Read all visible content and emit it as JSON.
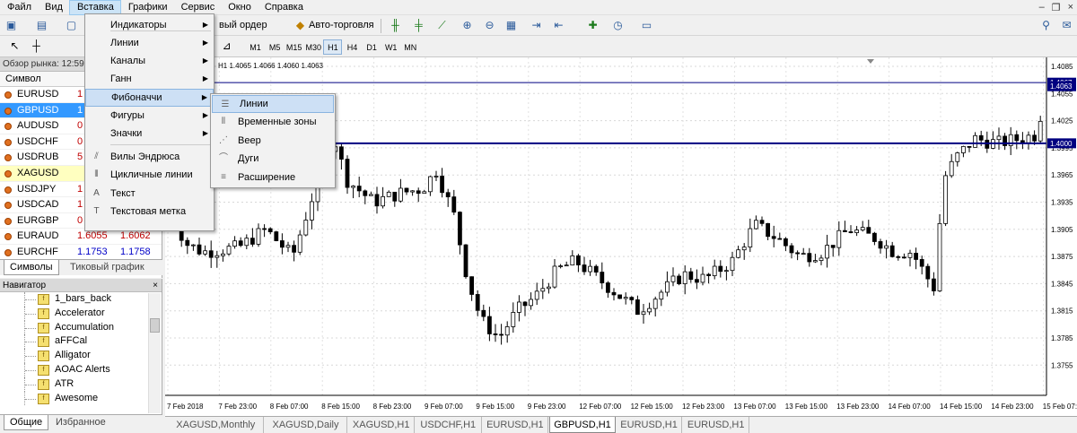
{
  "menubar": {
    "items": [
      "Файл",
      "Вид",
      "Вставка",
      "Графики",
      "Сервис",
      "Окно",
      "Справка"
    ],
    "active": 2
  },
  "toolbar": {
    "new_order": "вый ордер",
    "auto_trading": "Авто-торговля"
  },
  "timeframes": [
    "M1",
    "M5",
    "M15",
    "M30",
    "H1",
    "H4",
    "D1",
    "W1",
    "MN"
  ],
  "timeframe_selected": "H1",
  "market_watch": {
    "title": "Обзор рынка: 12:59",
    "header": "Символ",
    "rows": [
      {
        "symbol": "EURUSD",
        "bid": "1",
        "ask": ""
      },
      {
        "symbol": "GBPUSD",
        "bid": "1",
        "ask": ""
      },
      {
        "symbol": "AUDUSD",
        "bid": "0",
        "ask": ""
      },
      {
        "symbol": "USDCHF",
        "bid": "0",
        "ask": ""
      },
      {
        "symbol": "USDRUB",
        "bid": "5",
        "ask": ""
      },
      {
        "symbol": "XAGUSD",
        "bid": "",
        "ask": ""
      },
      {
        "symbol": "USDJPY",
        "bid": "1",
        "ask": ""
      },
      {
        "symbol": "USDCAD",
        "bid": "1",
        "ask": ""
      },
      {
        "symbol": "EURGBP",
        "bid": "0",
        "ask": ""
      },
      {
        "symbol": "EURAUD",
        "bid": "1.6055",
        "ask": "1.6062"
      },
      {
        "symbol": "EURCHF",
        "bid": "1.1753",
        "ask": "1.1758"
      }
    ],
    "tabs": [
      "Символы",
      "Тиковый график"
    ]
  },
  "navigator": {
    "title": "Навигатор",
    "close": "×",
    "items": [
      "1_bars_back",
      "Accelerator",
      "Accumulation",
      "aFFCal",
      "Alligator",
      "AOAC Alerts",
      "ATR",
      "Awesome"
    ],
    "tabs": [
      "Общие",
      "Избранное"
    ]
  },
  "insert_menu": {
    "items": [
      {
        "label": "Индикаторы",
        "submenu": true
      },
      {
        "label": "Линии",
        "submenu": true
      },
      {
        "label": "Каналы",
        "submenu": true
      },
      {
        "label": "Ганн",
        "submenu": true
      },
      {
        "label": "Фибоначчи",
        "submenu": true,
        "highlight": true
      },
      {
        "label": "Фигуры",
        "submenu": true
      },
      {
        "label": "Значки",
        "submenu": true
      },
      {
        "label": "Вилы Эндрюса",
        "icon": "pitchfork-icon"
      },
      {
        "label": "Цикличные линии",
        "icon": "cycle-lines-icon"
      },
      {
        "label": "Текст",
        "icon": "text-icon"
      },
      {
        "label": "Текстовая метка",
        "icon": "text-label-icon"
      }
    ]
  },
  "fibo_menu": {
    "items": [
      {
        "label": "Линии",
        "icon": "fibo-lines-icon",
        "highlight": true
      },
      {
        "label": "Временные зоны",
        "icon": "fibo-timezones-icon"
      },
      {
        "label": "Веер",
        "icon": "fibo-fan-icon"
      },
      {
        "label": "Дуги",
        "icon": "fibo-arcs-icon"
      },
      {
        "label": "Расширение",
        "icon": "fibo-expansion-icon"
      }
    ]
  },
  "chart": {
    "info": "H1  1.4065 1.4066 1.4060 1.4063",
    "price_levels": [
      "1.4085",
      "1.4055",
      "1.4025",
      "1.3995",
      "1.3965",
      "1.3935",
      "1.3905",
      "1.3875",
      "1.3845",
      "1.3815",
      "1.3785",
      "1.3755"
    ],
    "current_price": "1.4063",
    "hline_price": "1.4000",
    "hline_top_price": "1.4067",
    "time_labels": [
      "7 Feb 2018",
      "7 Feb 23:00",
      "8 Feb 07:00",
      "8 Feb 15:00",
      "8 Feb 23:00",
      "9 Feb 07:00",
      "9 Feb 15:00",
      "9 Feb 23:00",
      "12 Feb 07:00",
      "12 Feb 15:00",
      "12 Feb 23:00",
      "13 Feb 07:00",
      "13 Feb 15:00",
      "13 Feb 23:00",
      "14 Feb 07:00",
      "14 Feb 15:00",
      "14 Feb 23:00",
      "15 Feb 07:00"
    ],
    "colors": {
      "hline": "#000080",
      "candle": "#000000"
    }
  },
  "chart_tabs": [
    "XAGUSD,Monthly",
    "XAGUSD,Daily",
    "XAGUSD,H1",
    "USDCHF,H1",
    "EURUSD,H1",
    "GBPUSD,H1",
    "EURUSD,H1",
    "EURUSD,H1"
  ],
  "chart_tab_active": 5
}
